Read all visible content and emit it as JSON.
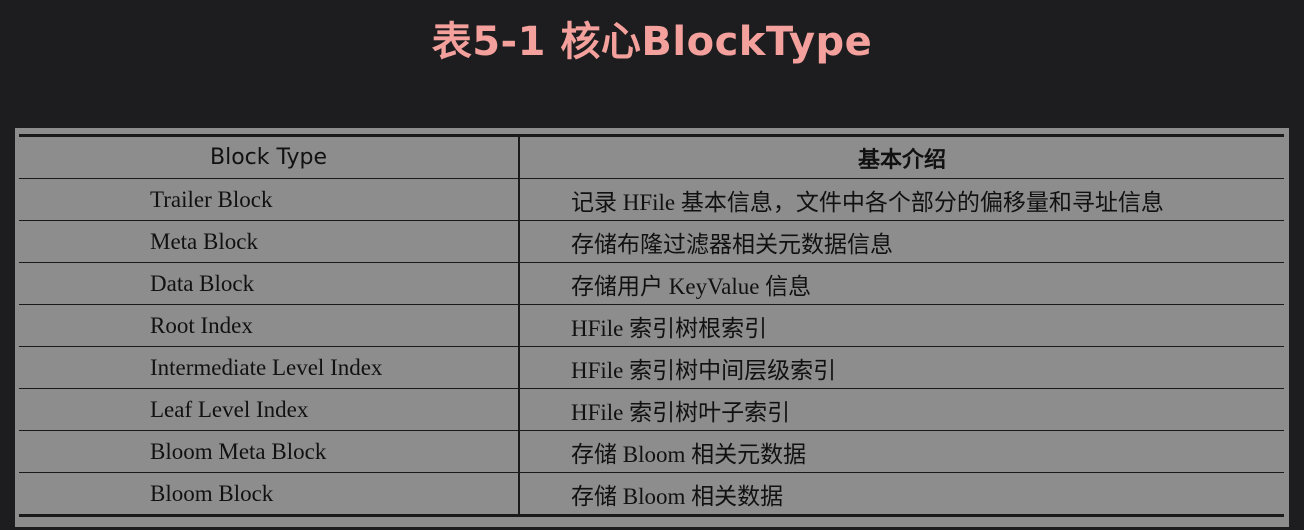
{
  "page": {
    "title": "表5-1 核心BlockType"
  },
  "table": {
    "headers": [
      "Block Type",
      "基本介绍"
    ],
    "rows": [
      {
        "type": "Trailer Block",
        "desc": "记录 HFile 基本信息，文件中各个部分的偏移量和寻址信息"
      },
      {
        "type": "Meta Block",
        "desc": "存储布隆过滤器相关元数据信息"
      },
      {
        "type": "Data Block",
        "desc": "存储用户 KeyValue 信息"
      },
      {
        "type": "Root Index",
        "desc": "HFile 索引树根索引"
      },
      {
        "type": "Intermediate Level Index",
        "desc": "HFile 索引树中间层级索引"
      },
      {
        "type": "Leaf Level Index",
        "desc": "HFile 索引树叶子索引"
      },
      {
        "type": "Bloom Meta Block",
        "desc": "存储 Bloom 相关元数据"
      },
      {
        "type": "Bloom Block",
        "desc": "存储 Bloom 相关数据"
      }
    ]
  },
  "colors": {
    "background": "#1d1d1f",
    "title": "#f4a19d",
    "table_background": "#8d8d8d",
    "table_text": "#111111"
  }
}
